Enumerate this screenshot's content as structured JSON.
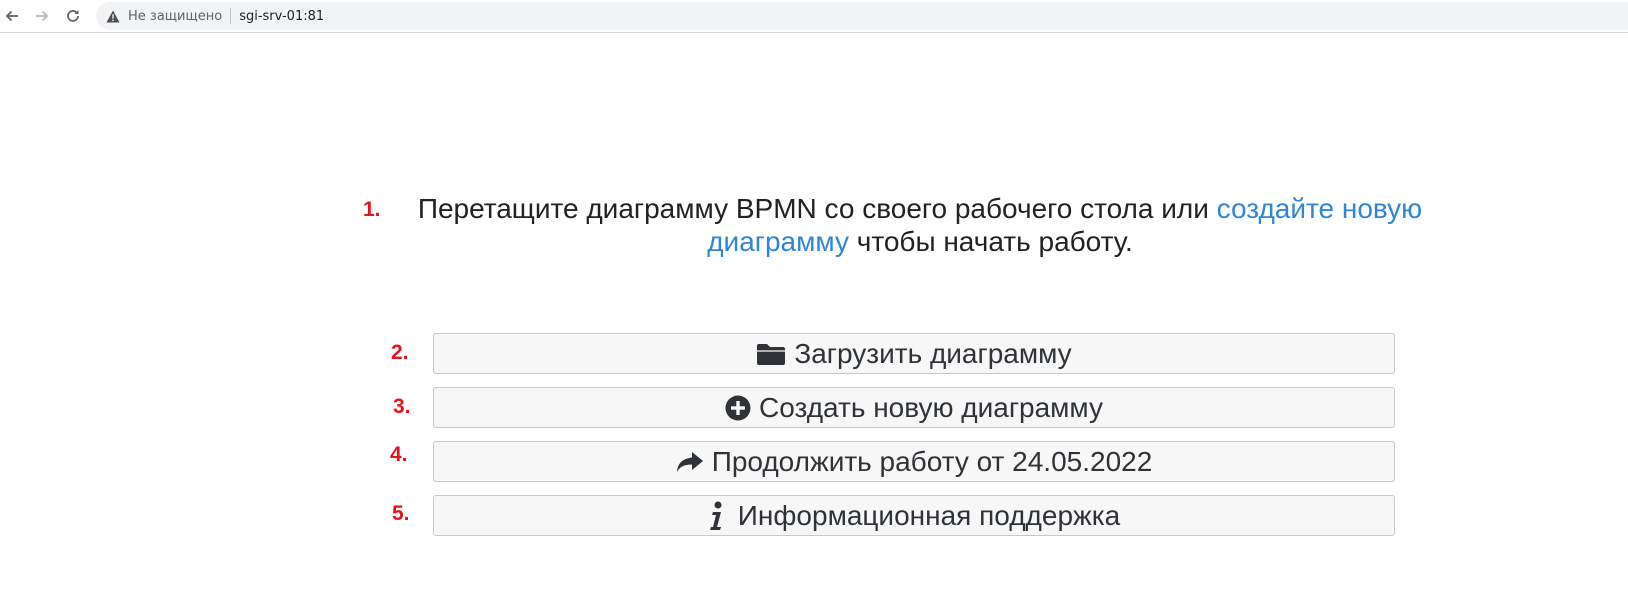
{
  "browser": {
    "security_label": "Не защищено",
    "url": "sgi-srv-01:81"
  },
  "intro": {
    "marker": "1.",
    "text_before": "Перетащите диаграмму BPMN со своего рабочего стола или ",
    "link_text_line1": "создайте новую",
    "link_text_line2": "диаграмму",
    "text_after": " чтобы начать работу."
  },
  "actions": [
    {
      "marker": "2.",
      "icon": "folder-icon",
      "label": "Загрузить диаграмму"
    },
    {
      "marker": "3.",
      "icon": "plus-circle-icon",
      "label": "Создать новую диаграмму"
    },
    {
      "marker": "4.",
      "icon": "share-arrow-icon",
      "label": "Продолжить работу от 24.05.2022"
    },
    {
      "marker": "5.",
      "icon": "info-icon",
      "label": "Информационная поддержка"
    }
  ],
  "colors": {
    "link": "#2f86d6",
    "marker": "#e8141c",
    "button_bg": "#f7f7f7",
    "button_text": "#2f3338"
  }
}
